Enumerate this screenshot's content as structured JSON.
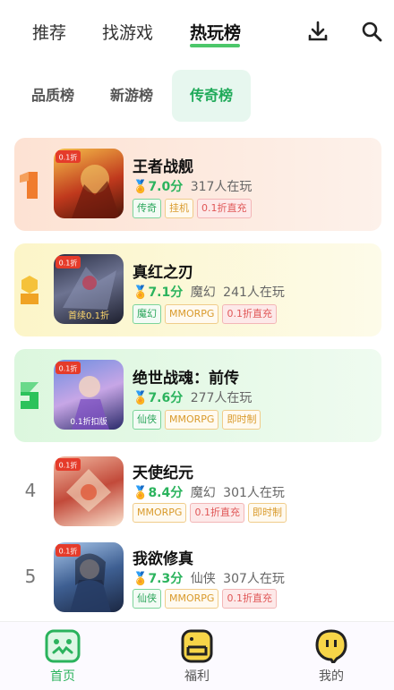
{
  "topnav": {
    "tabs": [
      {
        "label": "推荐"
      },
      {
        "label": "找游戏"
      },
      {
        "label": "热玩榜"
      }
    ],
    "active_index": 2,
    "download_icon": "download-icon",
    "search_icon": "search-icon"
  },
  "subtabs": [
    {
      "label": "品质榜"
    },
    {
      "label": "新游榜"
    },
    {
      "label": "传奇榜"
    }
  ],
  "games": [
    {
      "rank": "1",
      "name": "王者战舰",
      "score": "7.0分",
      "category": "",
      "players": "317人在玩",
      "tags": [
        "传奇",
        "挂机",
        "0.1折直充"
      ],
      "thumb_text": "0.1折"
    },
    {
      "rank": "2",
      "name": "真红之刃",
      "score": "7.1分",
      "category": "魔幻",
      "players": "241人在玩",
      "tags": [
        "魔幻",
        "MMORPG",
        "0.1折直充"
      ],
      "thumb_text": "首续0.1折"
    },
    {
      "rank": "3",
      "name": "绝世战魂：前传",
      "score": "7.6分",
      "category": "",
      "players": "277人在玩",
      "tags": [
        "仙侠",
        "MMORPG",
        "即时制"
      ],
      "thumb_text": "0.1折扣版"
    },
    {
      "rank": "4",
      "name": "天使纪元",
      "score": "8.4分",
      "category": "魔幻",
      "players": "301人在玩",
      "tags": [
        "MMORPG",
        "0.1折直充",
        "即时制"
      ],
      "thumb_text": "0.1折"
    },
    {
      "rank": "5",
      "name": "我欲修真",
      "score": "7.3分",
      "category": "仙侠",
      "players": "307人在玩",
      "tags": [
        "仙侠",
        "MMORPG",
        "0.1折直充"
      ],
      "thumb_text": "0.1折"
    }
  ],
  "bottombar": {
    "items": [
      {
        "label": "首页",
        "icon": "home-icon"
      },
      {
        "label": "福利",
        "icon": "gift-icon"
      },
      {
        "label": "我的",
        "icon": "profile-icon"
      }
    ]
  },
  "colors": {
    "accent": "#2bb35d",
    "rank1_bg": "#fde9dd",
    "rank2_bg": "#fdf8d8",
    "rank3_bg": "#e7f9e7"
  }
}
